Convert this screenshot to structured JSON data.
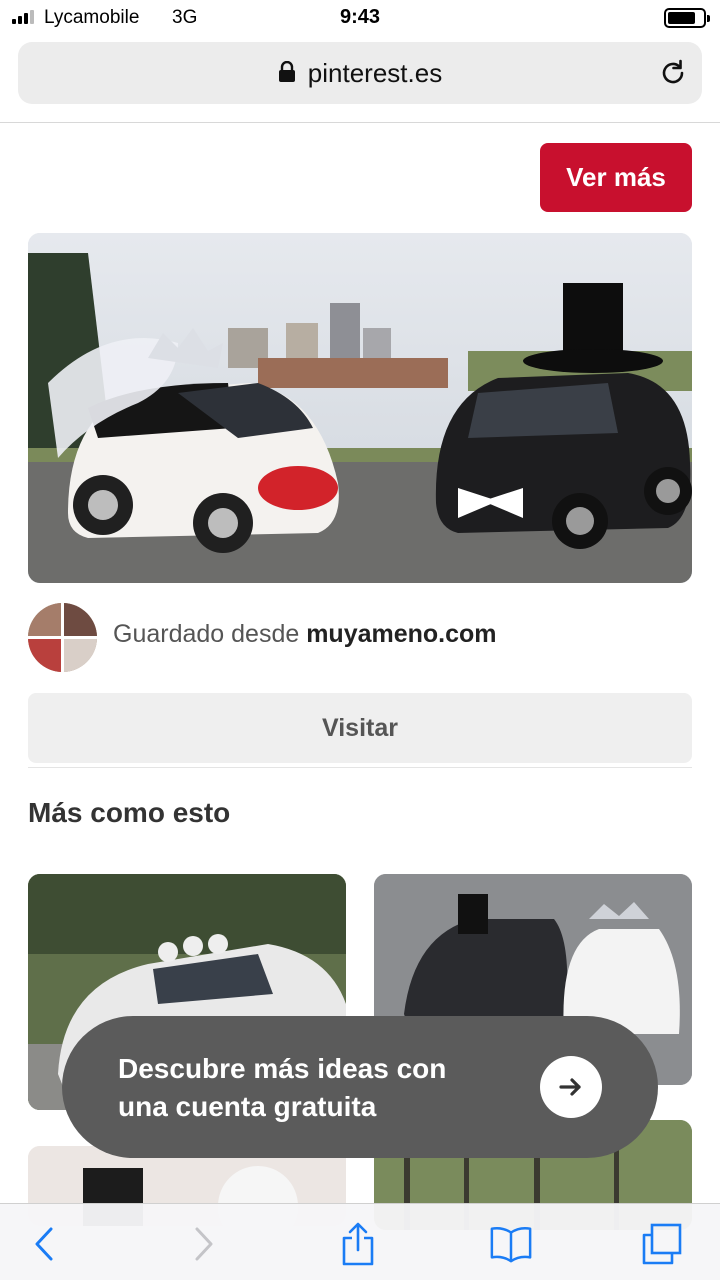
{
  "status_bar": {
    "carrier": "Lycamobile",
    "network": "3G",
    "time": "9:43"
  },
  "browser": {
    "url": "pinterest.es"
  },
  "pin": {
    "ver_mas_label": "Ver más",
    "saved_from_prefix": "Guardado desde ",
    "source_domain": "muyameno.com",
    "visit_label": "Visitar"
  },
  "more_like_this": {
    "title": "Más como esto"
  },
  "signup_toast": {
    "line1": "Descubre más ideas con",
    "line2": "una cuenta gratuita"
  },
  "colors": {
    "brand_red": "#c8102e",
    "toast_bg": "#5b5b5b",
    "ios_blue": "#1a7cf5"
  },
  "icons": {
    "lock": "lock-icon",
    "reload": "reload-icon",
    "back": "chevron-left-icon",
    "forward": "chevron-right-icon",
    "share": "share-icon",
    "bookmarks": "book-icon",
    "tabs": "tabs-icon",
    "arrow": "arrow-right-icon"
  }
}
